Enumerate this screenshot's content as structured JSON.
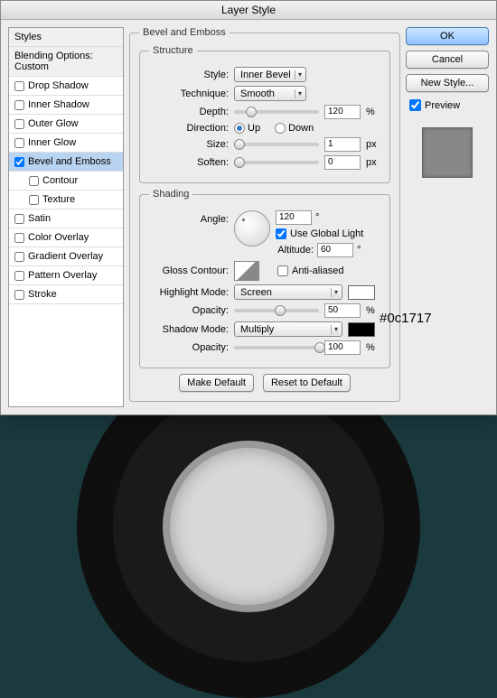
{
  "title": "Layer Style",
  "sidebar": {
    "styles": "Styles",
    "blending": "Blending Options: Custom",
    "items": [
      {
        "label": "Drop Shadow",
        "checked": false
      },
      {
        "label": "Inner Shadow",
        "checked": false
      },
      {
        "label": "Outer Glow",
        "checked": false
      },
      {
        "label": "Inner Glow",
        "checked": false
      },
      {
        "label": "Bevel and Emboss",
        "checked": true,
        "selected": true
      },
      {
        "label": "Contour",
        "checked": false,
        "sub": true
      },
      {
        "label": "Texture",
        "checked": false,
        "sub": true
      },
      {
        "label": "Satin",
        "checked": false
      },
      {
        "label": "Color Overlay",
        "checked": false
      },
      {
        "label": "Gradient Overlay",
        "checked": false
      },
      {
        "label": "Pattern Overlay",
        "checked": false
      },
      {
        "label": "Stroke",
        "checked": false
      }
    ]
  },
  "panel_title": "Bevel and Emboss",
  "structure": {
    "legend": "Structure",
    "style_label": "Style:",
    "style_value": "Inner Bevel",
    "technique_label": "Technique:",
    "technique_value": "Smooth",
    "depth_label": "Depth:",
    "depth_value": "120",
    "depth_unit": "%",
    "direction_label": "Direction:",
    "direction_up": "Up",
    "direction_down": "Down",
    "size_label": "Size:",
    "size_value": "1",
    "size_unit": "px",
    "soften_label": "Soften:",
    "soften_value": "0",
    "soften_unit": "px"
  },
  "shading": {
    "legend": "Shading",
    "angle_label": "Angle:",
    "angle_value": "120",
    "angle_unit": "°",
    "global_light": "Use Global Light",
    "altitude_label": "Altitude:",
    "altitude_value": "60",
    "altitude_unit": "°",
    "gloss_label": "Gloss Contour:",
    "anti_aliased": "Anti-aliased",
    "highlight_label": "Highlight Mode:",
    "highlight_value": "Screen",
    "opacity_label": "Opacity:",
    "highlight_opacity": "50",
    "shadow_label": "Shadow Mode:",
    "shadow_value": "Multiply",
    "shadow_opacity": "100",
    "percent": "%"
  },
  "buttons": {
    "ok": "OK",
    "cancel": "Cancel",
    "new_style": "New Style...",
    "preview": "Preview",
    "make_default": "Make Default",
    "reset_default": "Reset to Default"
  },
  "annotation": "#0c1717"
}
